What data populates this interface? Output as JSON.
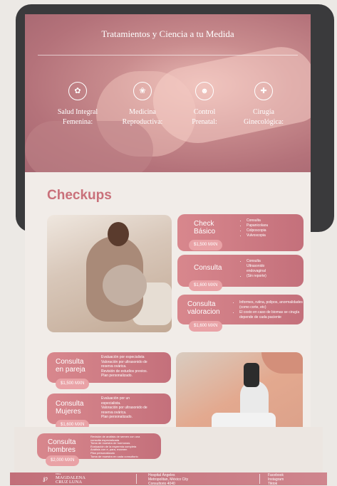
{
  "hero": {
    "title": "Tratamientos y Ciencia a tu Medida",
    "services": [
      {
        "icon": "uterus-icon",
        "line1": "Salud Integral",
        "line2": "Femenina:"
      },
      {
        "icon": "fertility-icon",
        "line1": "Medicina",
        "line2": "Reproductiva:"
      },
      {
        "icon": "baby-icon",
        "line1": "Control",
        "line2": "Prenatal:"
      },
      {
        "icon": "surgery-icon",
        "line1": "Cirugía",
        "line2": "Ginecológica:"
      }
    ]
  },
  "section_title": "Checkups",
  "cards": [
    {
      "title1": "Check",
      "title2": "Básico",
      "price": "$1,500 MXN",
      "items": [
        "Consulta",
        "Papanicolaou",
        "Colposcopia",
        "Vulvoscopia"
      ]
    },
    {
      "title1": "Consulta",
      "title2": "",
      "price": "$1,600 MXN",
      "items": [
        "Consulta",
        "Ultrasonido",
        "endovaginal",
        "(Sin reporte)"
      ]
    },
    {
      "title1": "Consulta",
      "title2": "valoracion",
      "price": "$1,600 MXN",
      "items": [
        "Informes, rutina, polipos, anormalidades (como corte, etc)",
        "El costo en caso de biomas se cirugía depende de cada paciente"
      ]
    },
    {
      "title1": "Consulta",
      "title2": "en pareja",
      "price": "$1,500 MXN",
      "desc": [
        "Evaluación por especialista",
        "Valoración por ultrasonido de",
        "reserva ovárica.",
        "Revisión de estudios previos.",
        "Plan personalizado."
      ]
    },
    {
      "title1": "Consulta",
      "title2": "Mujeres",
      "price": "$1,600 MXN",
      "desc": [
        "Evaluación por un",
        "especialista.",
        "Valoración por ultrasonido de",
        "reserva ovárica.",
        "Plan personalizado."
      ]
    },
    {
      "title1": "Consulta",
      "title2": "hombres",
      "price": "$2,000 MXN",
      "desc": [
        "Revisión de análisis de semen con una",
        "consulta especializada",
        "Toma de muestra de hormonas",
        "Evaluación de la espermia completa",
        "Análisis con e, para, examen",
        "Plan personalizado",
        "Toma de muestra en cada consultorio"
      ]
    }
  ],
  "footer": {
    "logo": "℘",
    "brand_prefix": "DRA.",
    "brand1": "MAGDALENA",
    "brand2": "CRUZ LUNA",
    "address1": "Hospital Ángeles",
    "address2": "Metropolitan, México City",
    "address3": "Consultorio 4040",
    "social1": "Facebook",
    "social2": "Instagram",
    "social3": "Tiktok"
  }
}
